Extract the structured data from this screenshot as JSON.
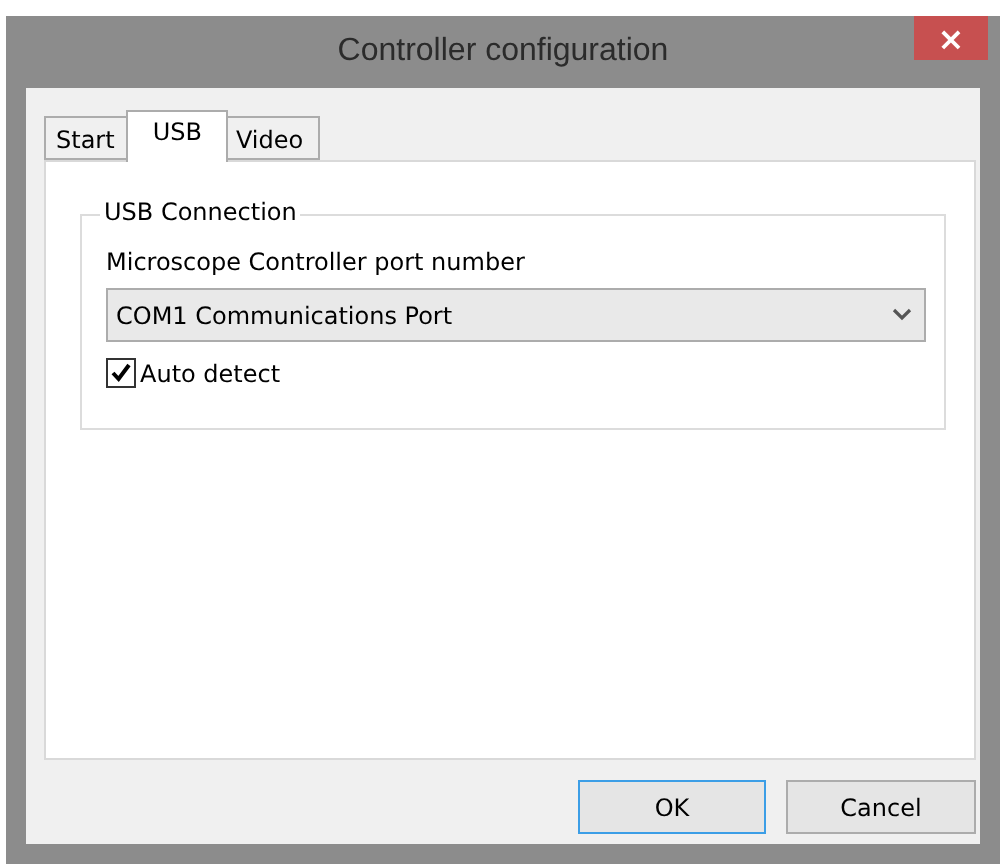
{
  "window": {
    "title": "Controller configuration",
    "close": "×"
  },
  "tabs": [
    {
      "label": "Start",
      "selected": false
    },
    {
      "label": "USB",
      "selected": true
    },
    {
      "label": "Video",
      "selected": false
    }
  ],
  "group": {
    "title": "USB Connection",
    "field_label": "Microscope Controller port number",
    "port": {
      "value": "COM1 Communications Port"
    },
    "auto_detect": {
      "label": "Auto detect",
      "checked": true
    }
  },
  "buttons": [
    {
      "label": "OK",
      "default": true
    },
    {
      "label": "Cancel",
      "default": false
    }
  ]
}
